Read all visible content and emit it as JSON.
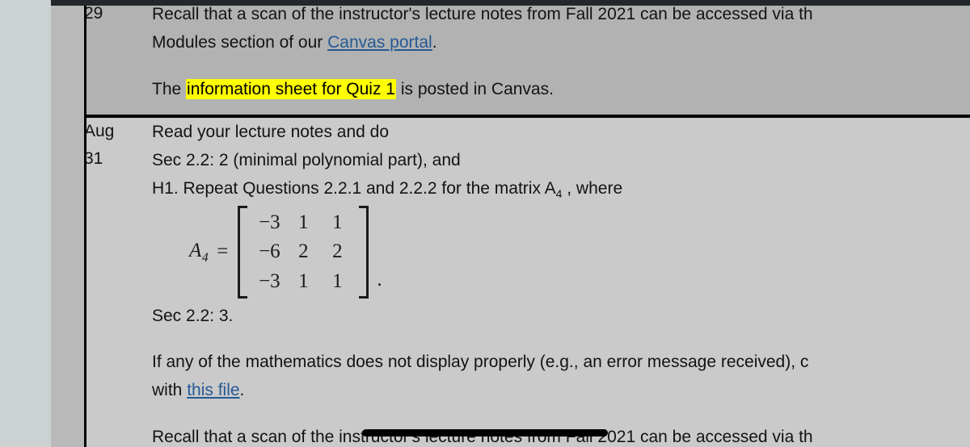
{
  "window": {
    "background_color": "#ccd1d1",
    "gutter_color": "#b9b9b9",
    "topbar_color": "#24272c"
  },
  "theme": {
    "row_shaded_color": "#b2b2b2",
    "row_plain_color": "#cacaca",
    "link_color": "#245a96",
    "highlight_color": "#ffff00",
    "text_color": "#131313",
    "rule_color": "#000000"
  },
  "schedule": {
    "rows": [
      {
        "date": "29",
        "date_month": "",
        "lines": [
          "Recall that a scan of the instructor's lecture notes from Fall 2021 can be accessed via th",
          "Modules section of our "
        ],
        "link_text": "Canvas portal",
        "after_link": ".",
        "notice_prefix": "The ",
        "notice_highlight": "information sheet for Quiz 1",
        "notice_suffix": " is posted in Canvas."
      },
      {
        "date_month": "Aug",
        "date_day": "31",
        "line1": "Read your lecture notes and do",
        "line2": "Sec 2.2: 2 (minimal polynomial part), and",
        "line3_a": "H1. Repeat Questions 2.2.1 and 2.2.2 for the matrix A",
        "line3_sub": "4",
        "line3_b": " , where",
        "matrix": {
          "label": "A",
          "label_sub": "4",
          "equals": "=",
          "rows": [
            [
              "−3",
              "1",
              "1"
            ],
            [
              "−6",
              "2",
              "2"
            ],
            [
              "−3",
              "1",
              "1"
            ]
          ],
          "trailing_punct": "."
        },
        "line4": "Sec 2.2: 3.",
        "line5": "If any of the mathematics does not display properly (e.g., an error message received), c",
        "line6_prefix": "with ",
        "line6_link": "this file",
        "line6_suffix": "."
      }
    ],
    "next_row_partial": "Recall that a scan of the instructor's lecture notes from Fall 2021 can be accessed via th"
  },
  "overlay": {
    "black_bar_label": "black-progress-bar"
  }
}
